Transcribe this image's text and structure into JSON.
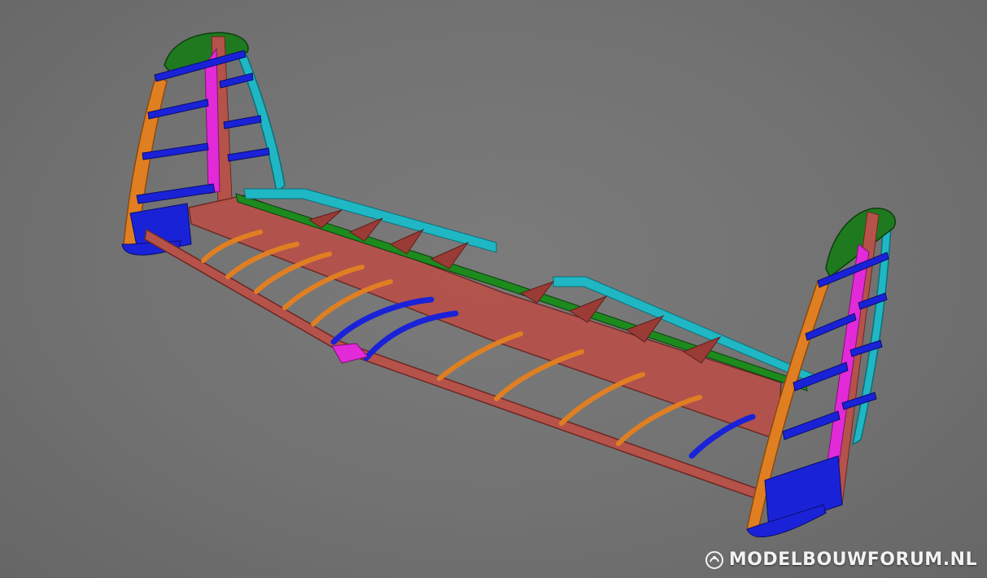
{
  "scene": {
    "subject": "3D CAD render of model aircraft tail section",
    "colors": {
      "background": "#727272",
      "spar": "#b5524a",
      "spar_dark": "#8f3a34",
      "rib": "#e07f22",
      "fin_rib": "#1a22d8",
      "fin_tip": "#1f7a1f",
      "leading_strip": "#1fb7c4",
      "web": "#e22ad8",
      "trailing_green": "#1d8a1d",
      "gusset": "#9a3b36"
    }
  },
  "watermark": {
    "text": "MODELBOUWFORUM.NL",
    "icon": "forum-logo-icon"
  }
}
